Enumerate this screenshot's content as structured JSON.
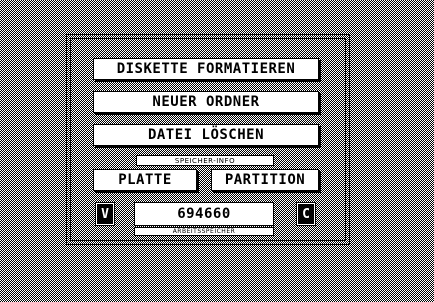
{
  "dialog": {
    "buttons": {
      "format": "DISKETTE FORMATIEREN",
      "new_folder": "NEUER ORDNER",
      "delete_file": "DATEI LÖSCHEN"
    },
    "storage_info_label": "SPEICHER-INFO",
    "storage_buttons": {
      "disk": "PLATTE",
      "partition": "PARTITION"
    },
    "left_box": "V",
    "right_box": "C",
    "memory_value": "694660",
    "memory_label": "ARBEITSSPEICHER"
  }
}
